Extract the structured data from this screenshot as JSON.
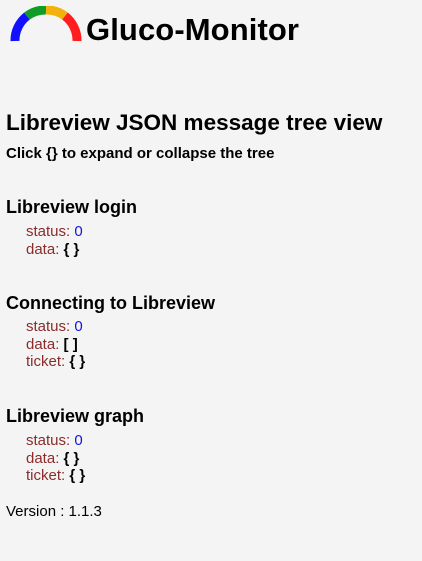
{
  "app": {
    "title": "Gluco-Monitor",
    "logo_icon": "gauge-arc-icon",
    "colors": {
      "blue": "#1111ff",
      "green": "#0f9d25",
      "yellow": "#f3b20b",
      "red": "#ff1d1d",
      "key": "#8b2b2b",
      "number": "#1515d8",
      "background": "#f4f4f4"
    }
  },
  "page": {
    "title": "Libreview JSON message tree view",
    "instruction": "Click {} to expand or collapse the tree"
  },
  "sections": [
    {
      "title": "Libreview login",
      "items": [
        {
          "key": "status",
          "value": "0"
        },
        {
          "key": "data",
          "value": "{ }"
        }
      ]
    },
    {
      "title": "Connecting to Libreview",
      "items": [
        {
          "key": "status",
          "value": "0"
        },
        {
          "key": "data",
          "value": "[ ]"
        },
        {
          "key": "ticket",
          "value": "{ }"
        }
      ]
    },
    {
      "title": "Libreview graph",
      "items": [
        {
          "key": "status",
          "value": "0"
        },
        {
          "key": "data",
          "value": "{ }"
        },
        {
          "key": "ticket",
          "value": "{ }"
        }
      ]
    }
  ],
  "footer": {
    "version_text": "Version : 1.1.3"
  }
}
